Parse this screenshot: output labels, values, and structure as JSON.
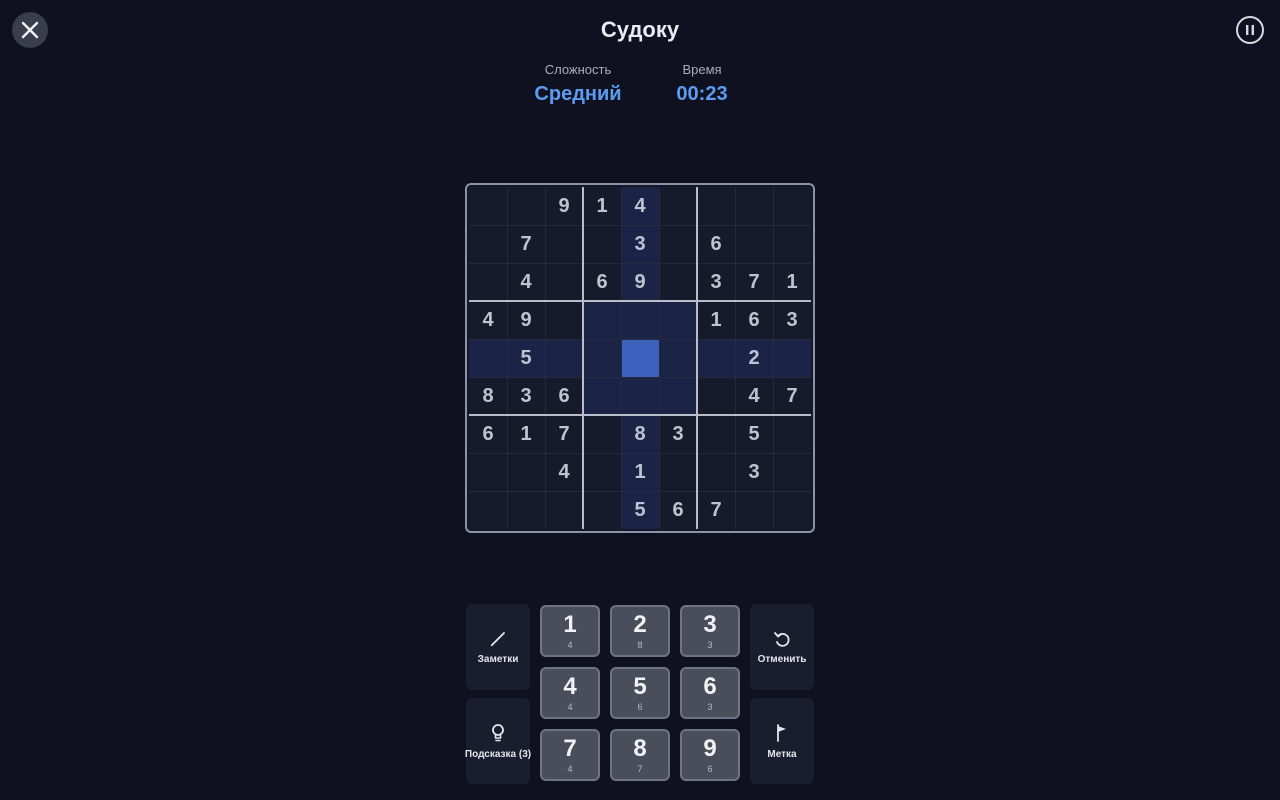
{
  "header": {
    "title": "Судоку",
    "close_icon": "close-icon",
    "pause_icon": "pause-icon"
  },
  "stats": {
    "difficulty_label": "Сложность",
    "difficulty_value": "Средний",
    "time_label": "Время",
    "time_value": "00:23"
  },
  "board": {
    "rows": [
      [
        "",
        "",
        "9",
        "1",
        "4",
        "",
        "",
        "",
        ""
      ],
      [
        "",
        "7",
        "",
        "",
        "3",
        "",
        "6",
        "",
        ""
      ],
      [
        "",
        "4",
        "",
        "6",
        "9",
        "",
        "3",
        "7",
        "1"
      ],
      [
        "4",
        "9",
        "",
        "",
        "",
        "",
        "1",
        "6",
        "3"
      ],
      [
        "",
        "5",
        "",
        "",
        "",
        "",
        "",
        "2",
        ""
      ],
      [
        "8",
        "3",
        "6",
        "",
        "",
        "",
        "",
        "4",
        "7"
      ],
      [
        "6",
        "1",
        "7",
        "",
        "8",
        "3",
        "",
        "5",
        ""
      ],
      [
        "",
        "",
        "4",
        "",
        "1",
        "",
        "",
        "3",
        ""
      ],
      [
        "",
        "",
        "",
        "",
        "5",
        "6",
        "7",
        "",
        ""
      ]
    ],
    "selected": {
      "row": 4,
      "col": 4
    },
    "colors": {
      "highlight": "#1b2446",
      "selected": "#3b63bd",
      "accent": "#5b9cf0"
    }
  },
  "tools": {
    "notes": {
      "label": "Заметки",
      "icon": "pencil-icon"
    },
    "undo": {
      "label": "Отменить",
      "icon": "undo-icon"
    },
    "hint": {
      "label": "Подсказка (3)",
      "icon": "lightbulb-icon"
    },
    "flag": {
      "label": "Метка",
      "icon": "flag-icon"
    }
  },
  "numpad": [
    {
      "digit": "1",
      "count": "4"
    },
    {
      "digit": "2",
      "count": "8"
    },
    {
      "digit": "3",
      "count": "3"
    },
    {
      "digit": "4",
      "count": "4"
    },
    {
      "digit": "5",
      "count": "6"
    },
    {
      "digit": "6",
      "count": "3"
    },
    {
      "digit": "7",
      "count": "4"
    },
    {
      "digit": "8",
      "count": "7"
    },
    {
      "digit": "9",
      "count": "6"
    }
  ]
}
